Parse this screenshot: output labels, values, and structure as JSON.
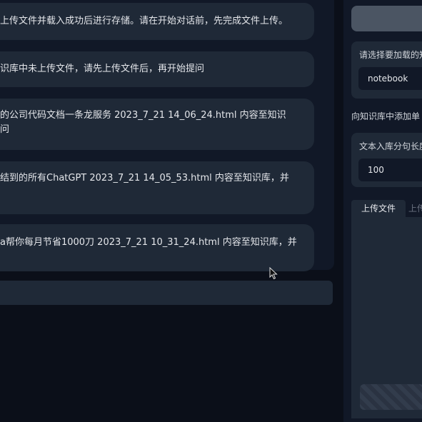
{
  "chat": {
    "messages": [
      "上传文件并载入成功后进行存储。请在开始对话前，先完成文件上传。",
      "识库中未上传文件，请先上传文件后，再开始提问",
      "的公司代码文档一条龙服务 2023_7_21 14_06_24.html 内容至知识\n问",
      "结到的所有ChatGPT 2023_7_21 14_05_53.html 内容至知识库，并",
      "a帮你每月节省1000刀 2023_7_21 10_31_24.html 内容至知识库，并"
    ],
    "input_value": ""
  },
  "sidebar": {
    "kb_select_label": "请选择要加载的知",
    "kb_select_value": "notebook",
    "add_section_title": "向知识库中添加单",
    "chunk_label": "文本入库分句长度",
    "chunk_value": "100",
    "tabs": [
      "上传文件",
      "上传"
    ]
  }
}
